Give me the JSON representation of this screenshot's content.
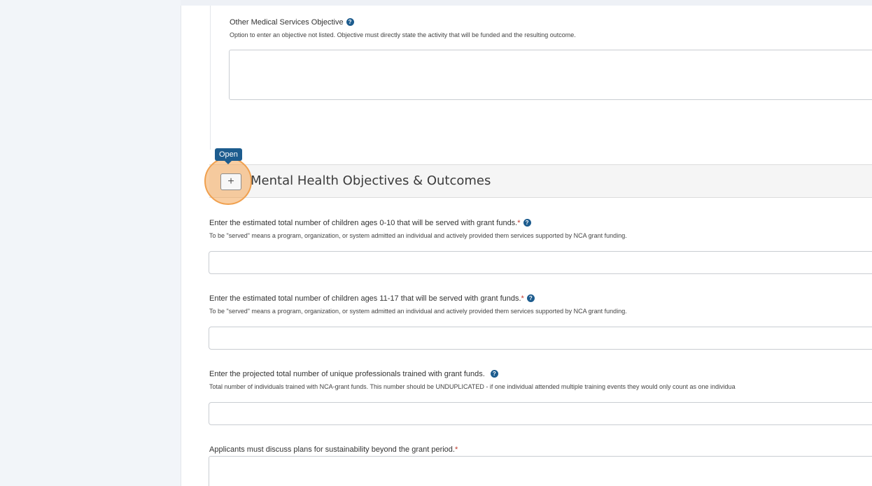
{
  "other_medical": {
    "label": "Other Medical Services Objective",
    "help": "Option to enter an objective not listed. Objective must directly state the activity that will be funded and the resulting outcome.",
    "value": ""
  },
  "section": {
    "tooltip": "Open",
    "toggle_symbol": "+",
    "title": "Mental Health Objectives & Outcomes"
  },
  "fields": [
    {
      "label": "Enter the estimated total number of children ages 0-10 that will be served with grant funds.",
      "required": "*",
      "help": "To be \"served\" means a program, organization, or system admitted an individual and actively provided them services supported by NCA grant funding.",
      "value": ""
    },
    {
      "label": "Enter the estimated total number of children ages 11-17 that will be served with grant funds.",
      "required": "*",
      "help": "To be \"served\" means a program, organization, or system admitted an individual and actively provided them services supported by NCA grant funding.",
      "value": ""
    },
    {
      "label": "Enter the projected total number of unique professionals trained with grant funds.",
      "required": "",
      "help": "Total number of individuals trained with NCA-grant funds. This number should be UNDUPLICATED - if one individual attended multiple training events they would only count as one individua",
      "value": ""
    },
    {
      "label": "Applicants must discuss plans for sustainability beyond the grant period.",
      "required": "*",
      "help": "",
      "value": ""
    }
  ],
  "icons": {
    "help": "question-circle-icon",
    "toggle": "plus-icon"
  },
  "colors": {
    "accent": "#1d5c8e",
    "highlight": "#f0a04e",
    "required": "#c0392b"
  },
  "help_glyph": "?"
}
